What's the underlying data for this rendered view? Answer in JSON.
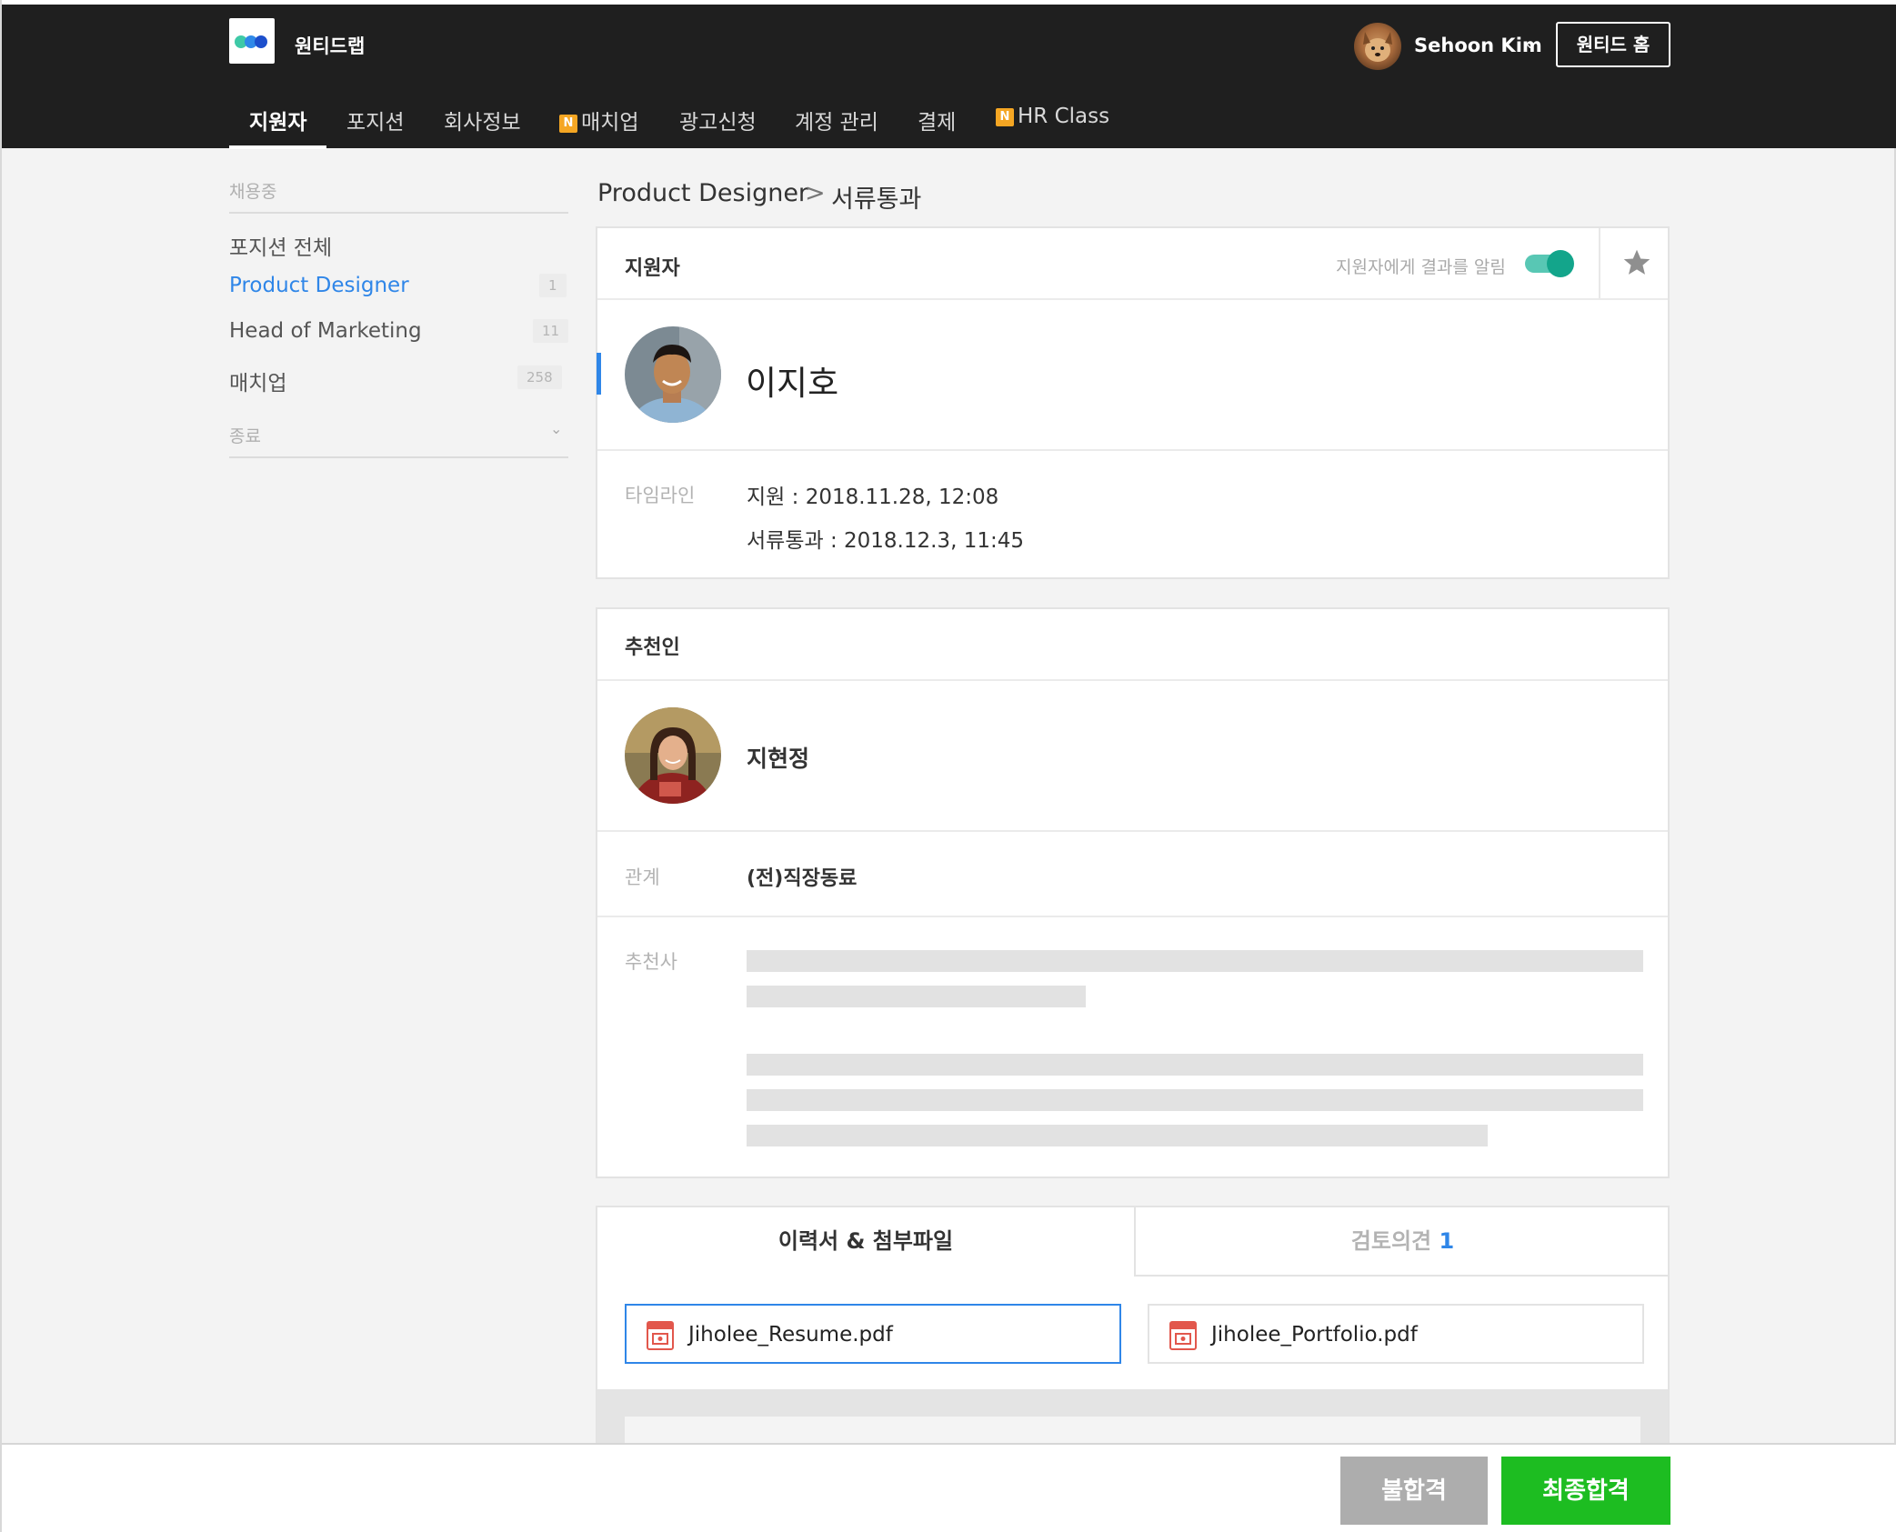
{
  "header": {
    "brand": "원티드랩",
    "user_name": "Sehoon Kim",
    "home_button": "원티드 홈",
    "badge_letter": "N",
    "nav": [
      "지원자",
      "포지션",
      "회사정보",
      "매치업",
      "광고신청",
      "계정 관리",
      "결제",
      "HR Class"
    ]
  },
  "sidebar": {
    "section_hiring": "채용중",
    "all_positions": "포지션 전체",
    "items": [
      {
        "label": "Product Designer",
        "count": "1"
      },
      {
        "label": "Head of Marketing",
        "count": "11"
      },
      {
        "label": "매치업",
        "count": "258"
      }
    ],
    "section_closed": "종료"
  },
  "breadcrumb": {
    "position": "Product Designer",
    "separator": ">",
    "stage": "서류통과"
  },
  "applicant_card": {
    "title": "지원자",
    "notify_label": "지원자에게 결과를 알림",
    "notify_on": true,
    "name": "이지호",
    "timeline_label": "타임라인",
    "timeline": [
      "지원 : 2018.11.28, 12:08",
      "서류통과 : 2018.12.3, 11:45"
    ]
  },
  "recommender_card": {
    "title": "추천인",
    "name": "지현정",
    "relation_label": "관계",
    "relation_value": "(전)직장동료",
    "recommendation_label": "추천사"
  },
  "documents": {
    "tab_resume": "이력서 & 첨부파일",
    "tab_review": "검토의견",
    "review_count": "1",
    "files": [
      "Jiholee_Resume.pdf",
      "Jiholee_Portfolio.pdf"
    ]
  },
  "footer": {
    "reject_label": "불합격",
    "accept_label": "최종합격"
  },
  "colors": {
    "accent": "#2f86e8",
    "toggle": "#13a58b",
    "accept": "#1dbd21",
    "reject": "#adadad",
    "topbar": "#1f1f1f"
  }
}
